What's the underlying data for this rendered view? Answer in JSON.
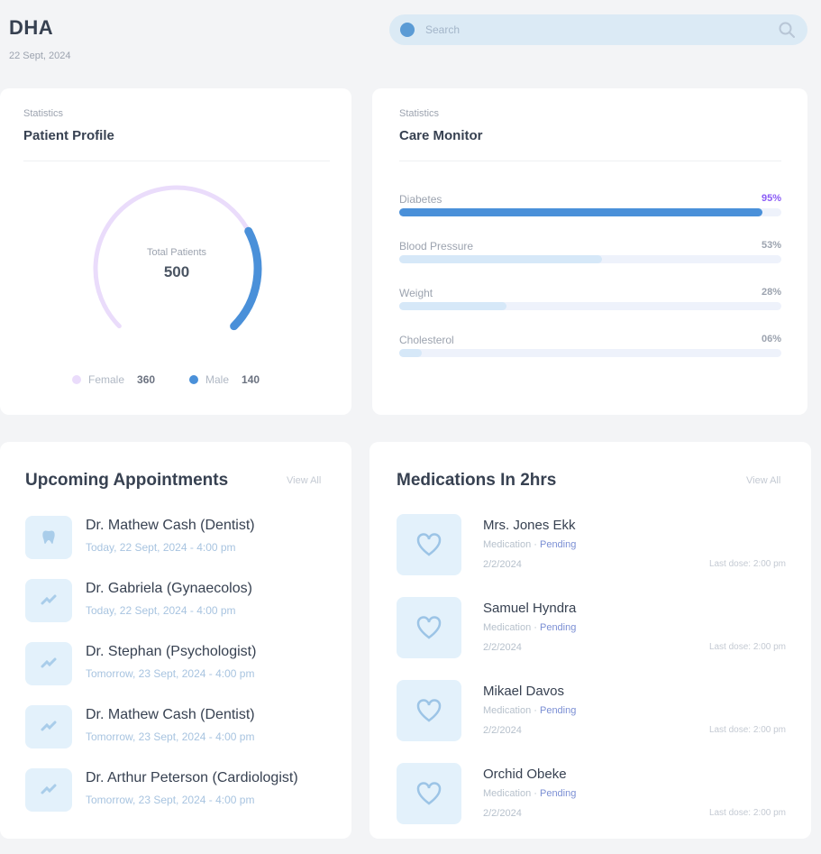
{
  "header": {
    "brand": "DHA",
    "date": "22 Sept, 2024",
    "search_placeholder": "Search",
    "search_value": ""
  },
  "profile_card": {
    "kicker": "Statistics",
    "title": "Patient Profile",
    "gauge_label": "Total Patients",
    "gauge_value": "500",
    "female_fraction": 0.72,
    "male_fraction": 0.28,
    "legend": [
      {
        "label": "Female",
        "value": "360",
        "color": "#eadcfb"
      },
      {
        "label": "Male",
        "value": "140",
        "color": "#4a90d9"
      }
    ]
  },
  "monitor_card": {
    "kicker": "Statistics",
    "title": "Care Monitor",
    "bars": [
      {
        "label": "Diabetes",
        "pct_text": "95%",
        "value": 0.95,
        "color": "#4a90d9",
        "accent": true
      },
      {
        "label": "Blood Pressure",
        "pct_text": "53%",
        "value": 0.53,
        "color": "#d6e8f8",
        "accent": false
      },
      {
        "label": "Weight",
        "pct_text": "28%",
        "value": 0.28,
        "color": "#d6e8f8",
        "accent": false
      },
      {
        "label": "Cholesterol",
        "pct_text": "06%",
        "value": 0.06,
        "color": "#d6e8f8",
        "accent": false
      }
    ]
  },
  "appointments": {
    "title": "Upcoming Appointments",
    "see_all": "View All",
    "items": [
      {
        "doctor": "Dr. Mathew Cash (Dentist)",
        "when": "Today, 22 Sept, 2024 - 4:00 pm",
        "icon": "tooth-icon"
      },
      {
        "doctor": "Dr. Gabriela (Gynaecolos)",
        "when": "Today, 22 Sept, 2024 - 4:00 pm",
        "icon": "stethoscope-icon"
      },
      {
        "doctor": "Dr. Stephan (Psychologist)",
        "when": "Tomorrow, 23 Sept, 2024 - 4:00 pm",
        "icon": "stethoscope-icon"
      },
      {
        "doctor": "Dr. Mathew Cash (Dentist)",
        "when": "Tomorrow, 23 Sept, 2024 - 4:00 pm",
        "icon": "stethoscope-icon"
      },
      {
        "doctor": "Dr. Arthur Peterson (Cardiologist)",
        "when": "Tomorrow, 23 Sept, 2024 - 4:00 pm",
        "icon": "stethoscope-icon"
      }
    ]
  },
  "medications": {
    "title": "Medications In 2hrs",
    "see_all": "View All",
    "items": [
      {
        "patient": "Mrs. Jones Ekk",
        "med": "Medication",
        "status": "Pending",
        "dose": "2/2/2024",
        "last": "Last dose: 2:00 pm"
      },
      {
        "patient": "Samuel Hyndra",
        "med": "Medication",
        "status": "Pending",
        "dose": "2/2/2024",
        "last": "Last dose: 2:00 pm"
      },
      {
        "patient": "Mikael Davos",
        "med": "Medication",
        "status": "Pending",
        "dose": "2/2/2024",
        "last": "Last dose: 2:00 pm"
      },
      {
        "patient": "Orchid Obeke",
        "med": "Medication",
        "status": "Pending",
        "dose": "2/2/2024",
        "last": "Last dose: 2:00 pm"
      }
    ]
  }
}
